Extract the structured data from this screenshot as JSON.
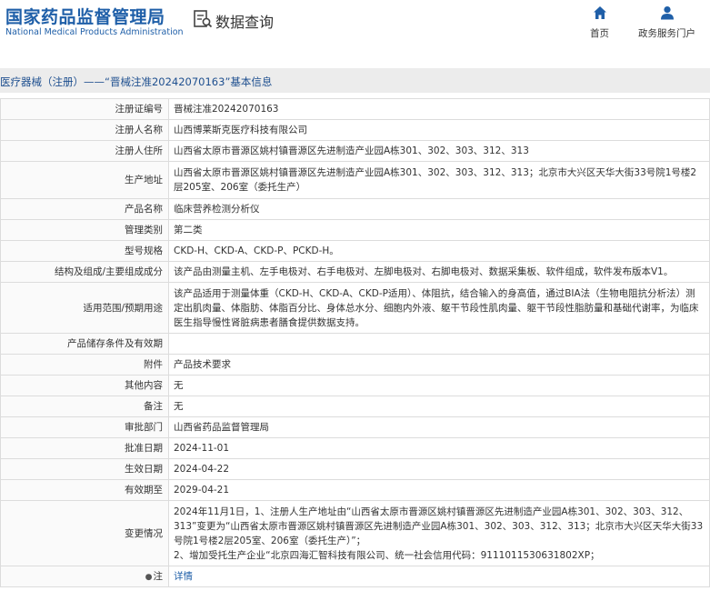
{
  "header": {
    "logo_cn": "国家药品监督管理局",
    "logo_en": "National Medical Products Administration",
    "search_title": "数据查询",
    "nav": [
      {
        "label": "首页",
        "icon": "home-icon"
      },
      {
        "label": "政务服务门户",
        "icon": "user-icon"
      }
    ]
  },
  "breadcrumb": "医疗器械（注册）——“晋械注准20242070163”基本信息",
  "colors": {
    "brand": "#1f5fa8",
    "breadcrumb_bg": "#ececec",
    "border": "#dcdcdc"
  },
  "rows": [
    {
      "k": "注册证编号",
      "v": "晋械注准20242070163"
    },
    {
      "k": "注册人名称",
      "v": "山西博莱斯克医疗科技有限公司"
    },
    {
      "k": "注册人住所",
      "v": "山西省太原市晋源区姚村镇晋源区先进制造产业园A栋301、302、303、312、313"
    },
    {
      "k": "生产地址",
      "v": "山西省太原市晋源区姚村镇晋源区先进制造产业园A栋301、302、303、312、313；北京市大兴区天华大街33号院1号楼2层205室、206室（委托生产）"
    },
    {
      "k": "产品名称",
      "v": "临床营养检测分析仪"
    },
    {
      "k": "管理类别",
      "v": "第二类"
    },
    {
      "k": "型号规格",
      "v": "CKD-H、CKD-A、CKD-P、PCKD-H。"
    },
    {
      "k": "结构及组成/主要组成成分",
      "v": "该产品由测量主机、左手电极对、右手电极对、左脚电极对、右脚电极对、数据采集板、软件组成，软件发布版本V1。"
    },
    {
      "k": "适用范围/预期用途",
      "v": "该产品适用于测量体重（CKD-H、CKD-A、CKD-P适用）、体阻抗，结合输入的身高值，通过BIA法（生物电阻抗分析法）测定出肌肉量、体脂肪、体脂百分比、身体总水分、细胞内外液、躯干节段性肌肉量、躯干节段性脂肪量和基础代谢率，为临床医生指导慢性肾脏病患者膳食提供数据支持。"
    },
    {
      "k": "产品储存条件及有效期",
      "v": ""
    },
    {
      "k": "附件",
      "v": "产品技术要求"
    },
    {
      "k": "其他内容",
      "v": "无"
    },
    {
      "k": "备注",
      "v": "无"
    },
    {
      "k": "审批部门",
      "v": "山西省药品监督管理局"
    },
    {
      "k": "批准日期",
      "v": "2024-11-01"
    },
    {
      "k": "生效日期",
      "v": "2024-04-22"
    },
    {
      "k": "有效期至",
      "v": "2029-04-21"
    },
    {
      "k": "变更情况",
      "v1": "2024年11月1日，1、注册人生产地址由“山西省太原市晋源区姚村镇晋源区先进制造产业园A栋301、302、303、312、313”变更为“山西省太原市晋源区姚村镇晋源区先进制造产业园A栋301、302、303、312、313；北京市大兴区天华大街33号院1号楼2层205室、206室（委托生产）”；",
      "v2": "2、增加受托生产企业“北京四海汇智科技有限公司、统一社会信用代码：9111011530631802XP；"
    },
    {
      "k": "注",
      "pin": "●",
      "v": "详情"
    }
  ]
}
